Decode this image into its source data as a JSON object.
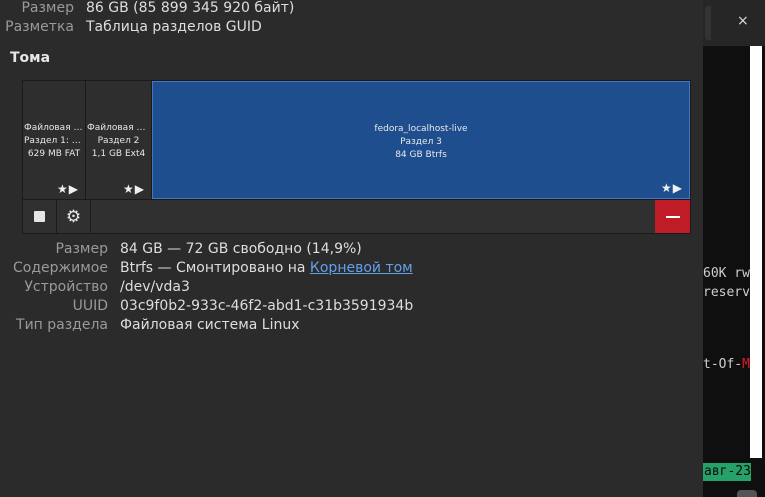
{
  "drive": {
    "size_label": "Размер",
    "size_value": "86 GB (85 899 345 920 байт)",
    "partitioning_label": "Разметка",
    "partitioning_value": "Таблица разделов GUID"
  },
  "volumes": {
    "heading": "Тома",
    "partitions": [
      {
        "line1": "Файловая си…",
        "line2": "Раздел 1: EFI…",
        "line3": "629 MB FAT",
        "marks": "★▶"
      },
      {
        "line1": "Файловая си…",
        "line2": "Раздел 2",
        "line3": "1,1 GB Ext4",
        "marks": "★▶"
      },
      {
        "line1": "fedora_localhost-live",
        "line2": "Раздел 3",
        "line3": "84 GB Btrfs",
        "marks": "★▶"
      }
    ]
  },
  "toolbar": {
    "stop_icon": "stop-icon",
    "gear_icon": "gear-icon",
    "delete_icon": "minus-icon",
    "delete_color": "#c01c28"
  },
  "details": {
    "size_label": "Размер",
    "size_value": "84 GB — 72 GB свободно (14,9%)",
    "contents_label": "Содержимое",
    "contents_prefix": "Btrfs — Смонтировано на ",
    "contents_link": "Корневой том",
    "device_label": "Устройство",
    "device_value": "/dev/vda3",
    "uuid_label": "UUID",
    "uuid_value": "03c9f0b2-933c-46f2-abd1-c31b3591934b",
    "type_label": "Тип раздела",
    "type_value": "Файловая система Linux"
  },
  "terminal": {
    "close_glyph": "×",
    "line1": "60K rw",
    "line2": "reserv",
    "line3_prefix": "t-Of-",
    "line3_red": "M",
    "date": "авг-23",
    "accent": "#26a269"
  }
}
